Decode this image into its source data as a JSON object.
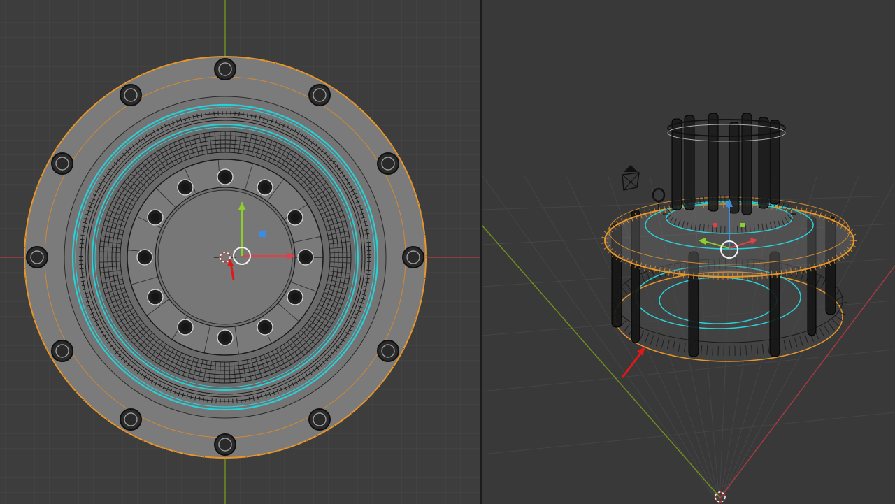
{
  "viewports": [
    {
      "id": "top-orthographic",
      "view": "top",
      "projection": "orthographic",
      "mode": "edit-mesh-x-ray"
    },
    {
      "id": "user-perspective",
      "view": "user",
      "projection": "perspective",
      "mode": "edit-mesh-x-ray"
    }
  ],
  "colors": {
    "background": "#3d3d3d",
    "grid_minor": "#454545",
    "grid_major": "#4d4d4d",
    "axis_x": "#a83a44",
    "axis_y": "#6d8f1f",
    "mesh_face": "#7a7a7a",
    "wire": "#1a1a1a",
    "selected_edge": "#e8962a",
    "seam": "#2ad0d8",
    "gizmo_x": "#e0404a",
    "gizmo_y": "#8ccf2a",
    "gizmo_z": "#3a8ce6",
    "annotation_arrow": "#e01818"
  },
  "icons": [
    "3d-cursor-icon",
    "transform-gizmo-icon",
    "camera-icon",
    "light-icon",
    "annotation-arrow-icon"
  ]
}
